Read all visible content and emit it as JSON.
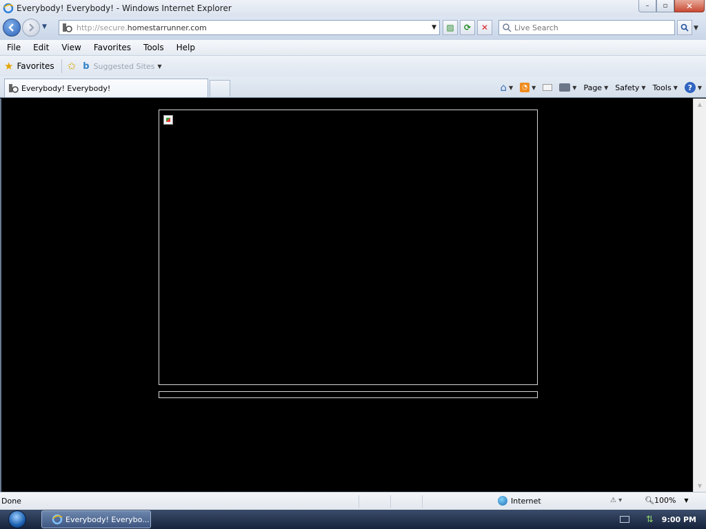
{
  "window": {
    "title": "Everybody! Everybody! - Windows Internet Explorer",
    "controls": {
      "minimize": "–",
      "maximize": "▫",
      "close": "✕"
    }
  },
  "nav": {
    "url_dim": "http://secure.",
    "url_main": "homestarrunner.com",
    "search_placeholder": "Live Search"
  },
  "menu": [
    "File",
    "Edit",
    "View",
    "Favorites",
    "Tools",
    "Help"
  ],
  "favorites_bar": {
    "favorites_label": "Favorites",
    "suggested_label": "Suggested Sites"
  },
  "tab": {
    "label": "Everybody! Everybody!"
  },
  "command_bar": {
    "page": "Page",
    "safety": "Safety",
    "tools": "Tools"
  },
  "status": {
    "text": "Done",
    "zone": "Internet",
    "zoom": "100%"
  },
  "taskbar": {
    "task_label": "Everybody! Everybo...",
    "clock": "9:00 PM"
  },
  "colors": {
    "content_bg": "#000000",
    "frame_border": "#d8d8d8"
  }
}
